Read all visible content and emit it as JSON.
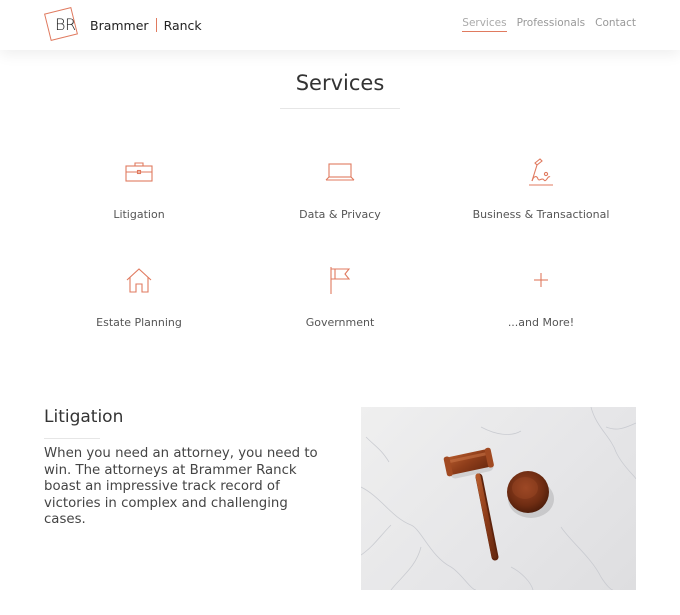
{
  "brand": {
    "initials": "BR",
    "name_first": "Brammer",
    "name_second": "Ranck",
    "accent_color": "#e07a5f"
  },
  "nav": {
    "items": [
      {
        "label": "Services",
        "active": true
      },
      {
        "label": "Professionals",
        "active": false
      },
      {
        "label": "Contact",
        "active": false
      }
    ]
  },
  "services": {
    "title": "Services",
    "items": [
      {
        "label": "Litigation",
        "icon": "briefcase-icon"
      },
      {
        "label": "Data & Privacy",
        "icon": "laptop-icon"
      },
      {
        "label": "Business & Transactional",
        "icon": "signature-icon"
      },
      {
        "label": "Estate Planning",
        "icon": "house-icon"
      },
      {
        "label": "Government",
        "icon": "flag-icon"
      },
      {
        "label": "...and More!",
        "icon": "plus-icon"
      }
    ]
  },
  "litigation": {
    "heading": "Litigation",
    "body": "When you need an attorney, you need to win. The attorneys at Brammer Ranck boast an impressive track record of victories in complex and challenging cases.",
    "image": "gavel-on-marble-photo"
  }
}
